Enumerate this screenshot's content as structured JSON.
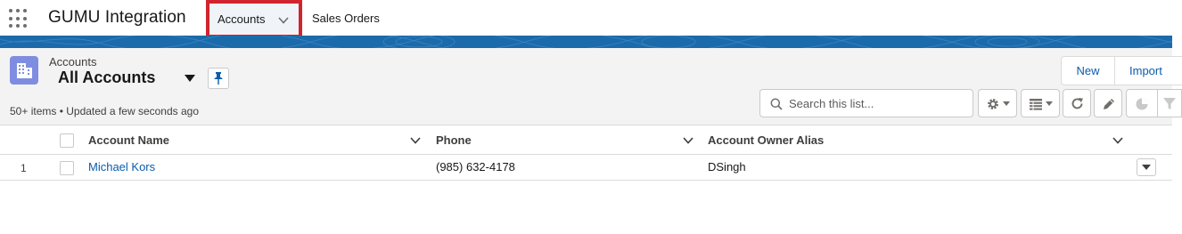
{
  "nav": {
    "app_name": "GUMU Integration",
    "tabs": [
      {
        "label": "Accounts",
        "active": true,
        "has_menu": true
      },
      {
        "label": "Sales Orders",
        "active": false
      }
    ]
  },
  "colors": {
    "banner": "#1b6bab",
    "accent_link": "#0b5cab",
    "highlight_border": "#d0252f",
    "object_icon": "#7f8de1"
  },
  "list_view": {
    "object_label": "Accounts",
    "view_name": "All Accounts",
    "meta": "50+ items • Updated a few seconds ago",
    "actions": {
      "new_label": "New",
      "import_label": "Import"
    },
    "search": {
      "placeholder": "Search this list...",
      "value": ""
    },
    "toolbar_icons": [
      "gear-icon",
      "table-view-icon",
      "refresh-icon",
      "pencil-icon",
      "chart-icon",
      "filter-icon"
    ]
  },
  "table": {
    "columns": [
      "Account Name",
      "Phone",
      "Account Owner Alias"
    ],
    "rows": [
      {
        "num": "1",
        "name": "Michael Kors",
        "phone": "(985) 632-4178",
        "owner": "DSingh"
      }
    ]
  }
}
